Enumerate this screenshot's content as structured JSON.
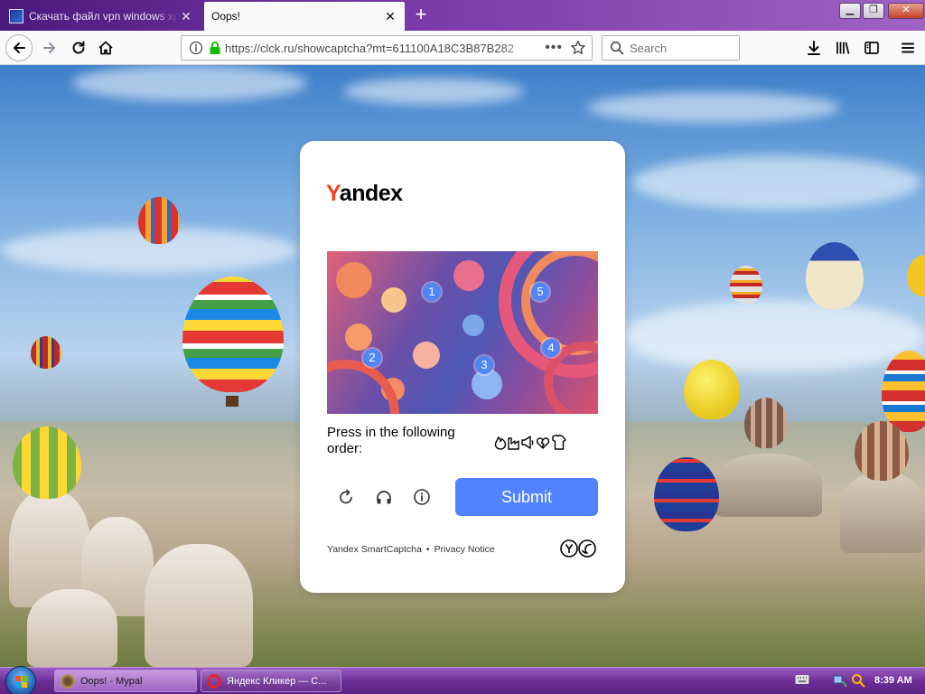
{
  "browser": {
    "tabs": [
      {
        "title": "Скачать файл vpn windows xp"
      },
      {
        "title": "Oops!"
      }
    ],
    "url": "https://clck.ru/showcaptcha?mt=611100A18C3B87B282",
    "search_placeholder": "Search"
  },
  "captcha": {
    "logo": {
      "first": "Y",
      "rest": "andex"
    },
    "markers": [
      "1",
      "2",
      "3",
      "4",
      "5"
    ],
    "instruction": "Press in the following order:",
    "order_icons": [
      "flame-icon",
      "factory-icon",
      "megaphone-icon",
      "broken-heart-icon",
      "shirt-icon"
    ],
    "submit_label": "Submit",
    "footer": {
      "smartcaptcha": "Yandex SmartCaptcha",
      "separator": "•",
      "privacy": "Privacy Notice"
    },
    "brand_color": "#fc3f1d",
    "button_color": "#5282ff"
  },
  "taskbar": {
    "items": [
      {
        "label": "Oops! - Mypal"
      },
      {
        "label": "Яндекс Кликер — С..."
      }
    ],
    "time": "8:39 AM"
  }
}
